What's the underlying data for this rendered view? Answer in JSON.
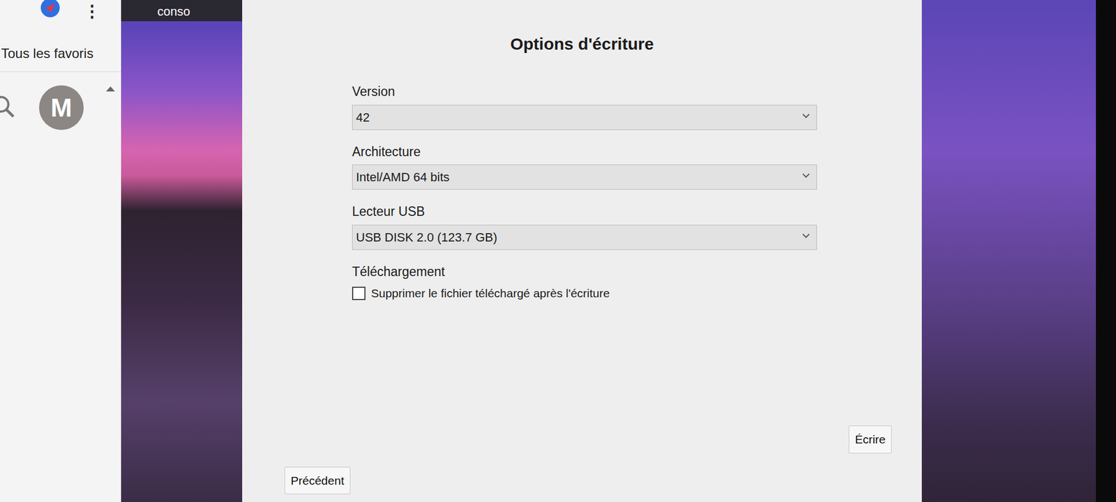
{
  "browser_sidebar": {
    "menu_icon": "⋮",
    "title": "Tous les favoris",
    "avatar": "M"
  },
  "background_window": {
    "title": "conso"
  },
  "dialog": {
    "title": "Options d'écriture",
    "fields": [
      {
        "label": "Version",
        "value": "42"
      },
      {
        "label": "Architecture",
        "value": "Intel/AMD 64 bits"
      },
      {
        "label": "Lecteur USB",
        "value": "USB DISK 2.0 (123.7 GB)"
      }
    ],
    "download": {
      "label": "Téléchargement",
      "checkbox": {
        "text": "Supprimer le fichier téléchargé après l'écriture",
        "checked": false
      }
    },
    "buttons": {
      "write": "Écrire",
      "previous": "Précédent"
    }
  }
}
